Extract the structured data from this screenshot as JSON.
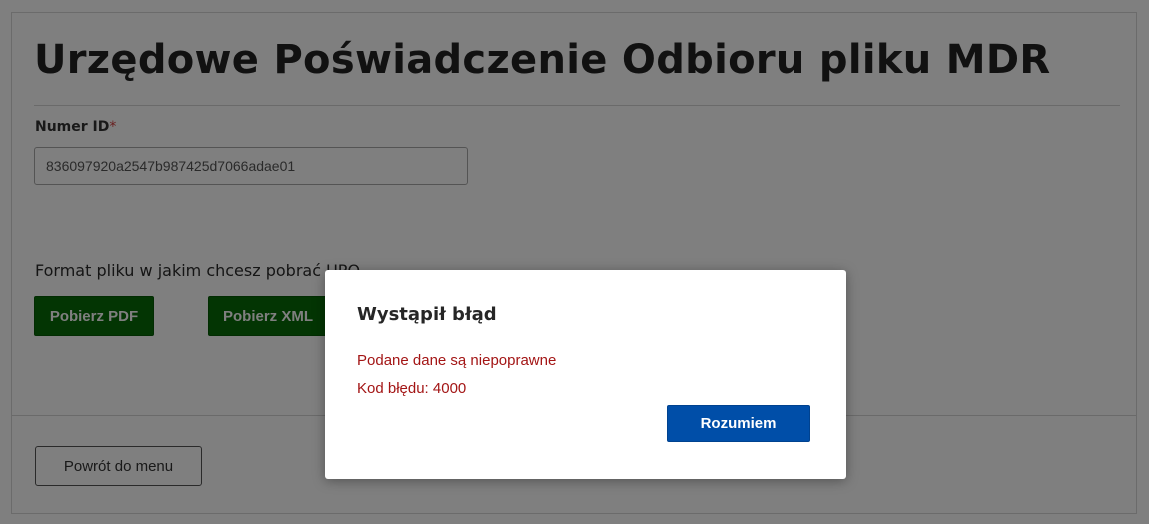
{
  "page": {
    "title": "Urzędowe Poświadczenie Odbioru pliku MDR"
  },
  "form": {
    "id_label": "Numer ID",
    "required_mark": "*",
    "id_value": "836097920a2547b987425d7066adae01",
    "format_label": "Format pliku w jakim chcesz pobrać UPO"
  },
  "buttons": {
    "pdf_label": "Pobierz PDF",
    "xml_label": "Pobierz XML",
    "back_label": "Powrót do menu"
  },
  "modal": {
    "title": "Wystąpił błąd",
    "message": "Podane dane są niepoprawne",
    "error_code": "Kod błędu: 4000",
    "confirm_label": "Rozumiem"
  },
  "colors": {
    "download_button": "#066b06",
    "confirm_button": "#004ea8",
    "error_text": "#a31515",
    "required_mark": "#d23c3c"
  }
}
